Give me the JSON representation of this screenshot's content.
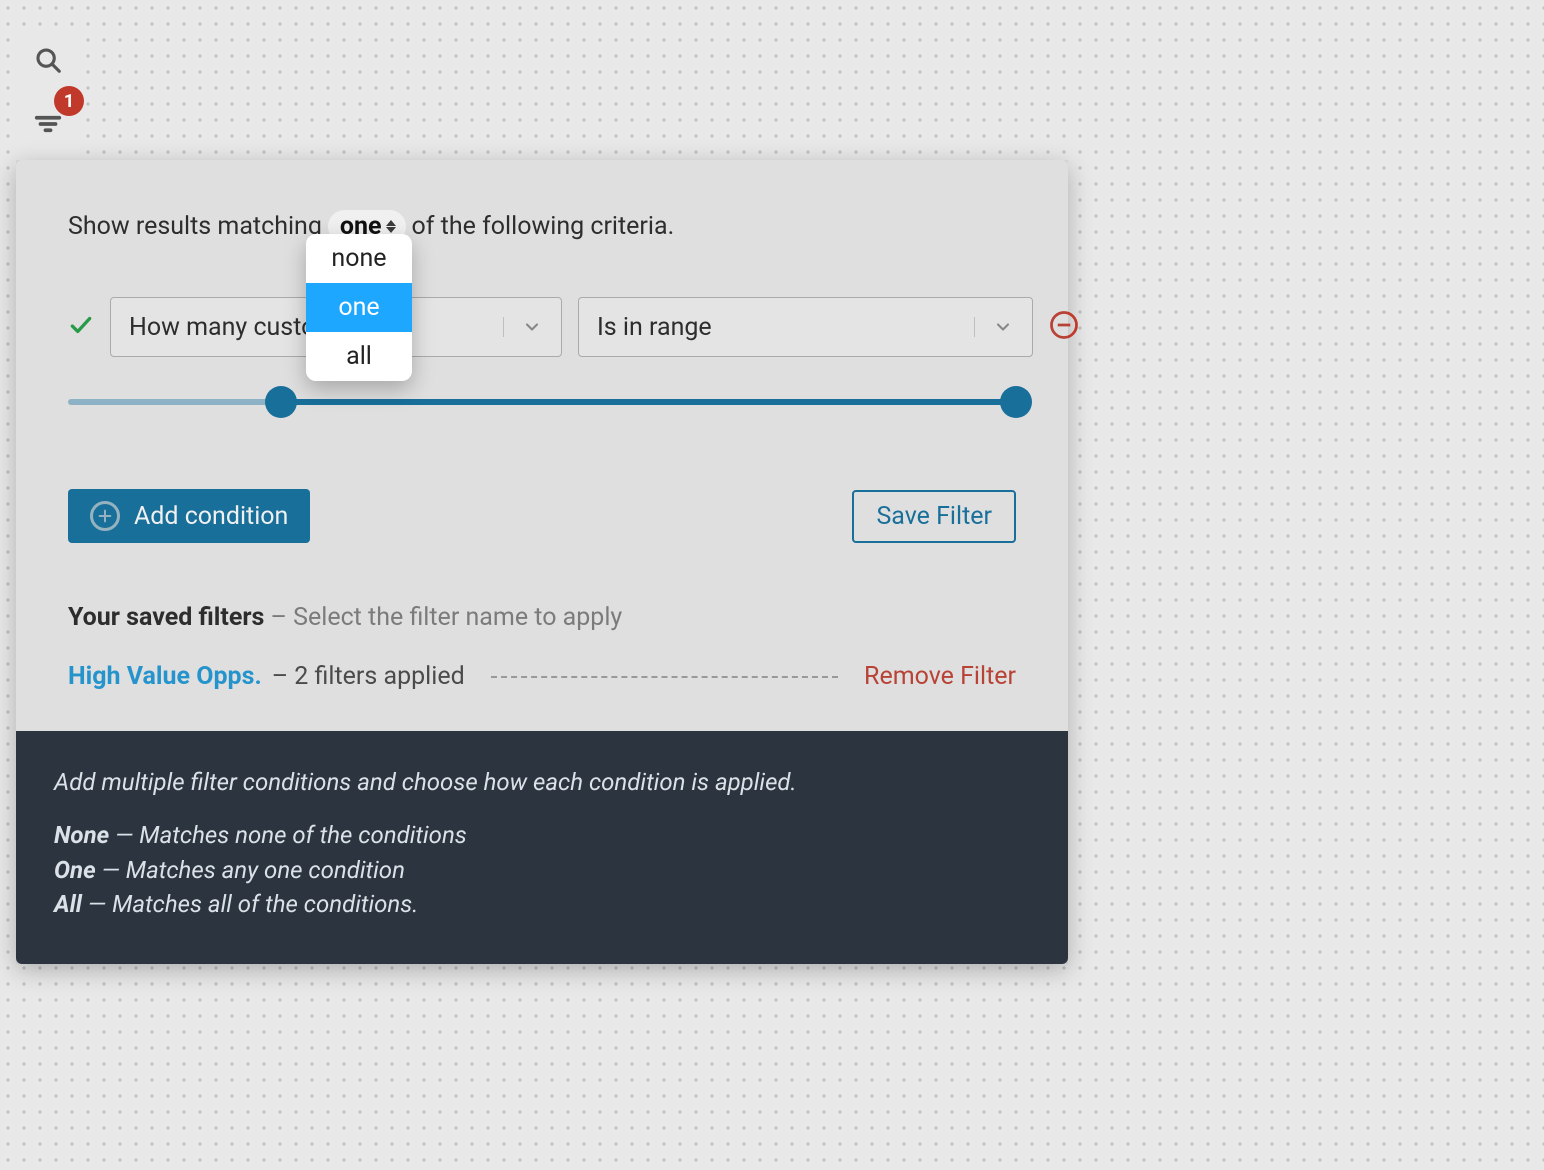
{
  "toolbar": {
    "filter_badge": "1"
  },
  "filter_builder": {
    "sentence_prefix": "Show results matching",
    "sentence_suffix": "of the following criteria.",
    "match_mode_selected": "one",
    "match_mode_options": [
      "none",
      "one",
      "all"
    ],
    "condition": {
      "field_label_truncated": "How many customers          c...",
      "operator_label": "Is in range",
      "enabled": true
    },
    "slider": {
      "low_pct": 22.5,
      "high_pct": 100
    },
    "add_condition_label": "Add condition",
    "save_filter_label": "Save Filter",
    "saved_filters_title": "Your saved filters",
    "saved_filters_subtitle": " – Select the filter name to apply",
    "saved_filter": {
      "name": "High Value Opps.",
      "meta": " – 2 filters applied",
      "remove_label": "Remove Filter"
    },
    "help": {
      "intro": "Add multiple filter conditions and choose how each condition is applied.",
      "lines": [
        {
          "term": "None",
          "desc": " — Matches none of the conditions"
        },
        {
          "term": "One",
          "desc": " — Matches any one condition"
        },
        {
          "term": "All",
          "desc": " — Matches all of the conditions."
        }
      ]
    }
  }
}
